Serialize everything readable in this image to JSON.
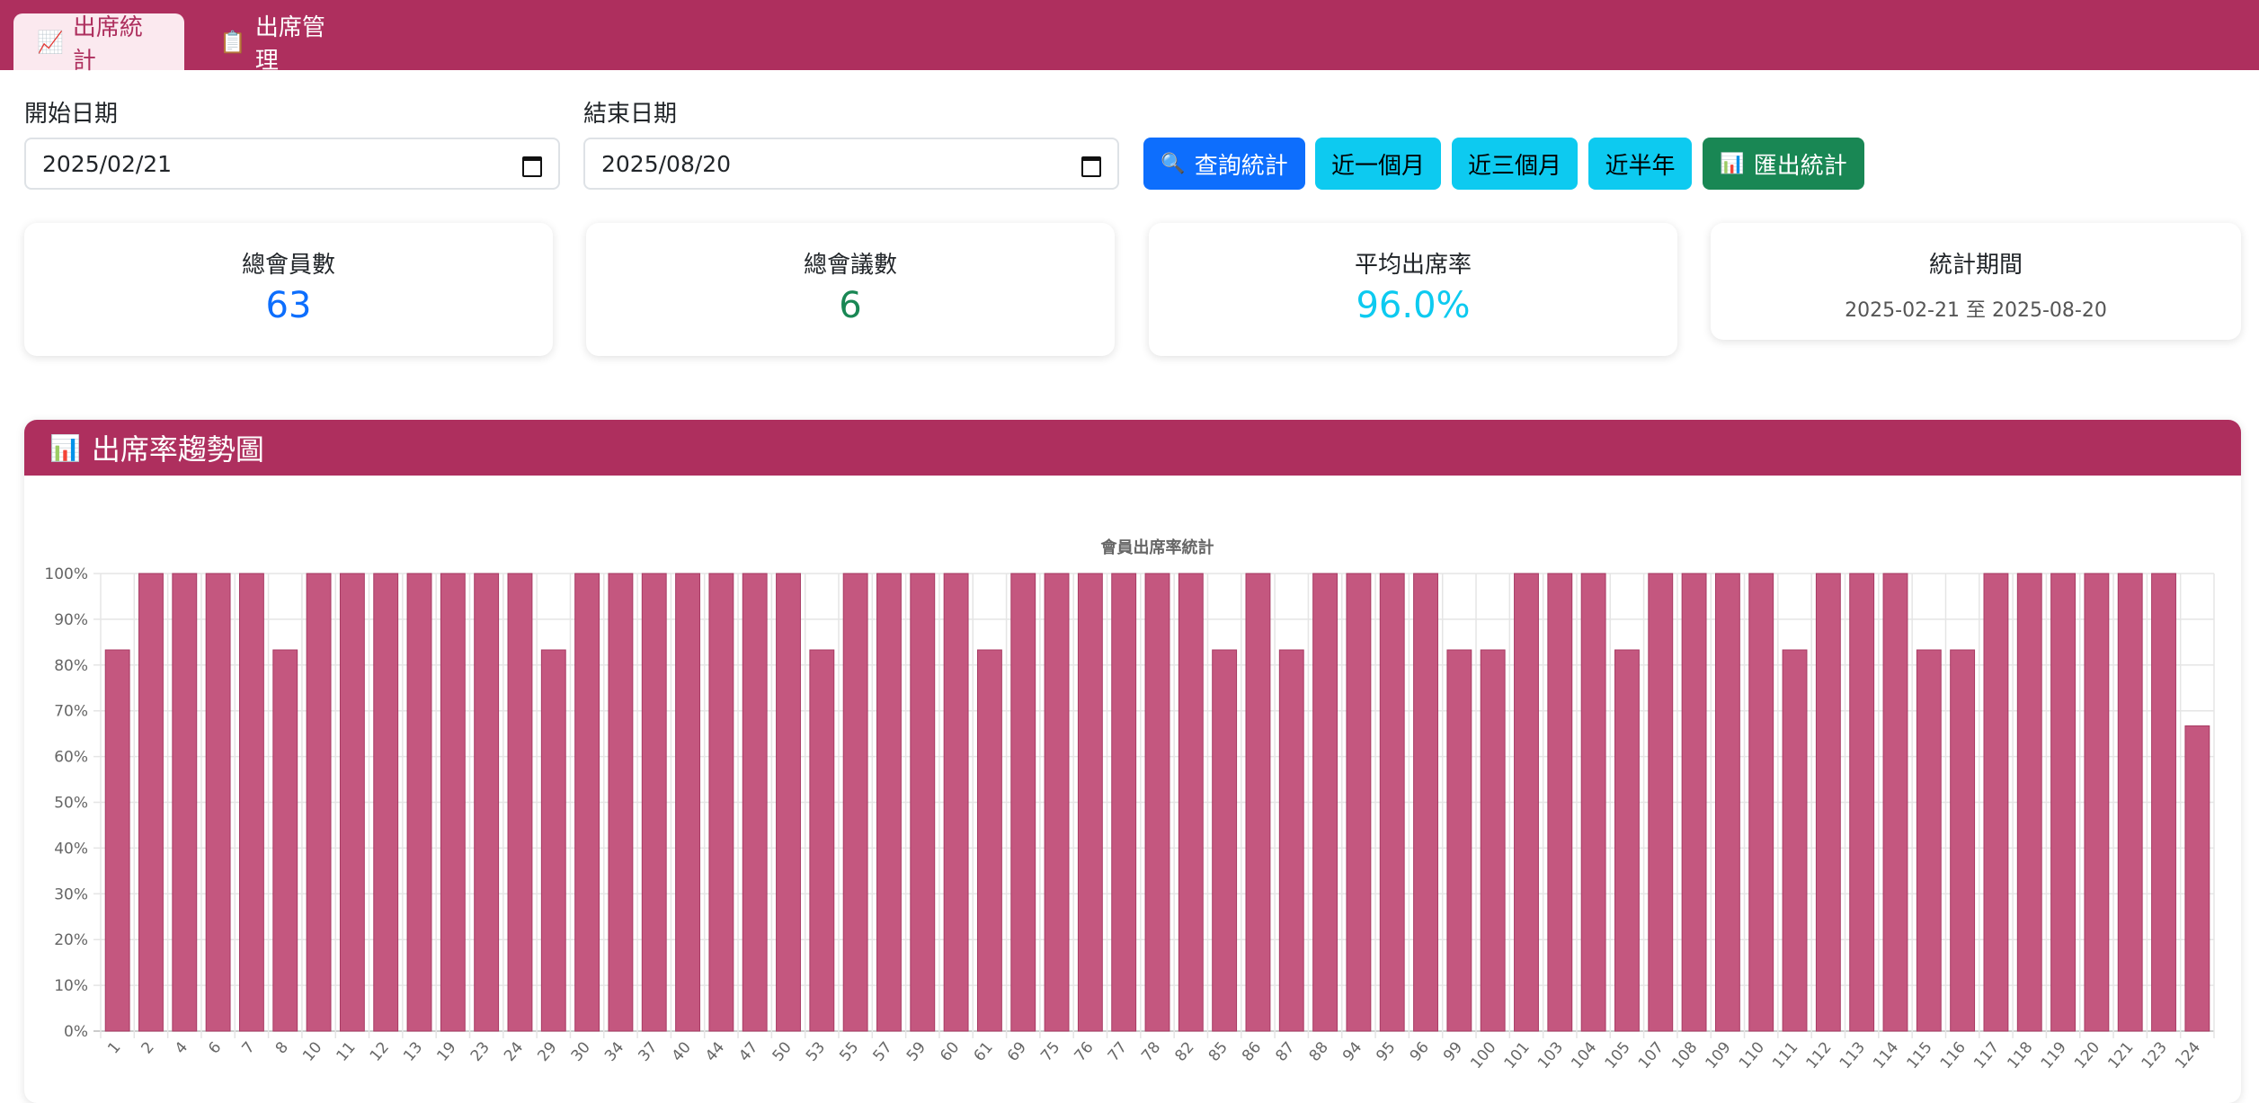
{
  "tabs": [
    {
      "icon": "📈",
      "label": "出席統計",
      "active": true
    },
    {
      "icon": "📋",
      "label": "出席管理",
      "active": false
    }
  ],
  "filters": {
    "start_label": "開始日期",
    "start_value": "2025/02/21",
    "end_label": "結束日期",
    "end_value": "2025/08/20"
  },
  "buttons": {
    "query": {
      "icon": "🔍",
      "label": "查詢統計"
    },
    "one_month": "近一個月",
    "three_months": "近三個月",
    "half_year": "近半年",
    "export": {
      "icon": "📊",
      "label": "匯出統計"
    }
  },
  "stats": {
    "members_label": "總會員數",
    "members_value": "63",
    "meetings_label": "總會議數",
    "meetings_value": "6",
    "rate_label": "平均出席率",
    "rate_value": "96.0%",
    "period_label": "統計期間",
    "period_value": "2025-02-21 至 2025-08-20"
  },
  "chart_panel": {
    "icon": "📊",
    "title": "出席率趨勢圖"
  },
  "colors": {
    "brand": "#ae2f5e",
    "bar_fill": "#c4577f",
    "bar_stroke": "#a83a63",
    "members_value": "#0d6efd",
    "meetings_value": "#198754",
    "rate_value": "#0dcaf0"
  },
  "chart_data": {
    "type": "bar",
    "title": "會員出席率統計",
    "xlabel": "",
    "ylabel": "",
    "ylim": [
      0,
      100
    ],
    "yticks": [
      "0%",
      "10%",
      "20%",
      "30%",
      "40%",
      "50%",
      "60%",
      "70%",
      "80%",
      "90%",
      "100%"
    ],
    "grid": true,
    "categories": [
      "1",
      "2",
      "4",
      "6",
      "7",
      "8",
      "10",
      "11",
      "12",
      "13",
      "19",
      "23",
      "24",
      "29",
      "30",
      "34",
      "37",
      "40",
      "44",
      "47",
      "50",
      "53",
      "55",
      "57",
      "59",
      "60",
      "61",
      "69",
      "75",
      "76",
      "77",
      "78",
      "82",
      "85",
      "86",
      "87",
      "88",
      "94",
      "95",
      "96",
      "99",
      "100",
      "101",
      "103",
      "104",
      "105",
      "107",
      "108",
      "109",
      "110",
      "111",
      "112",
      "113",
      "114",
      "115",
      "116",
      "117",
      "118",
      "119",
      "120",
      "121",
      "123",
      "124"
    ],
    "values": [
      83.3,
      100,
      100,
      100,
      100,
      83.3,
      100,
      100,
      100,
      100,
      100,
      100,
      100,
      83.3,
      100,
      100,
      100,
      100,
      100,
      100,
      100,
      83.3,
      100,
      100,
      100,
      100,
      83.3,
      100,
      100,
      100,
      100,
      100,
      100,
      83.3,
      100,
      83.3,
      100,
      100,
      100,
      100,
      83.3,
      83.3,
      100,
      100,
      100,
      83.3,
      100,
      100,
      100,
      100,
      83.3,
      100,
      100,
      100,
      83.3,
      83.3,
      100,
      100,
      100,
      100,
      100,
      100,
      66.7
    ]
  }
}
